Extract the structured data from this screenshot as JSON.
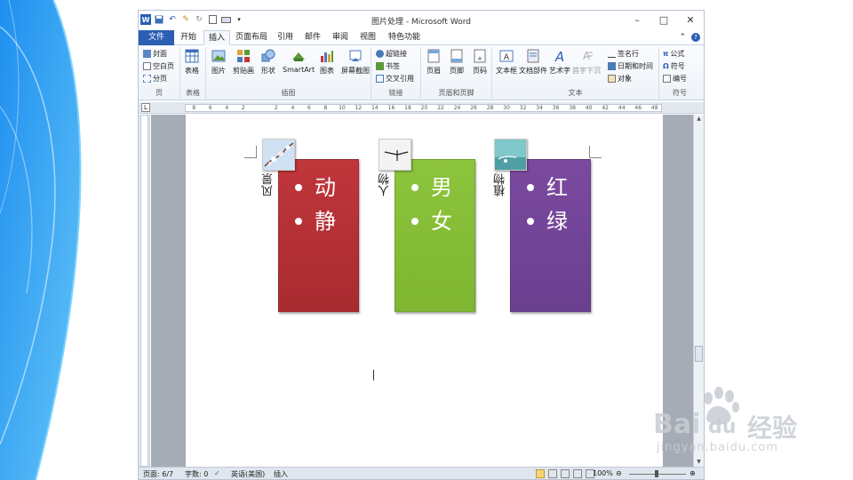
{
  "window": {
    "title": "图片处理 - Microsoft Word",
    "controls": {
      "minimize": "–",
      "maximize": "□",
      "close": "✕"
    }
  },
  "qat": {
    "icons": [
      "word-app-icon",
      "save-icon",
      "undo-icon",
      "format-painter-icon",
      "redo-icon",
      "new-doc-icon",
      "print-preview-icon",
      "customize-qat-icon"
    ]
  },
  "tabs": [
    {
      "label": "文件"
    },
    {
      "label": "开始"
    },
    {
      "label": "插入"
    },
    {
      "label": "页面布局"
    },
    {
      "label": "引用"
    },
    {
      "label": "邮件"
    },
    {
      "label": "审阅"
    },
    {
      "label": "视图"
    },
    {
      "label": "特色功能"
    }
  ],
  "active_tab": "插入",
  "ribbon": {
    "pages": {
      "label": "页",
      "items": [
        "封面",
        "空白页",
        "分页"
      ]
    },
    "tables": {
      "label": "表格",
      "items": [
        "表格"
      ]
    },
    "illustrations": {
      "label": "插图",
      "items": [
        "图片",
        "剪贴画",
        "形状",
        "SmartArt",
        "图表",
        "屏幕截图"
      ]
    },
    "links": {
      "label": "链接",
      "items": [
        "超链接",
        "书签",
        "交叉引用"
      ]
    },
    "header_footer": {
      "label": "页眉和页脚",
      "items": [
        "页眉",
        "页脚",
        "页码"
      ]
    },
    "text": {
      "label": "文本",
      "items": [
        "文本框",
        "文档部件",
        "艺术字",
        "首字下沉"
      ],
      "side": [
        "签名行",
        "日期和时间",
        "对象"
      ]
    },
    "symbols": {
      "label": "符号",
      "items": [
        "公式",
        "符号",
        "编号"
      ]
    }
  },
  "ruler": {
    "labels": [
      "8",
      "6",
      "4",
      "2",
      "",
      "2",
      "4",
      "6",
      "8",
      "10",
      "12",
      "14",
      "16",
      "18",
      "20",
      "22",
      "24",
      "26",
      "28",
      "30",
      "32",
      "34",
      "36",
      "38",
      "40",
      "42",
      "44",
      "46",
      "48"
    ]
  },
  "diagram": {
    "cards": [
      {
        "label": "风景",
        "items": [
          "动",
          "静"
        ],
        "color": "#c0363b",
        "color2": "#a82b30"
      },
      {
        "label": "人物",
        "items": [
          "男",
          "女"
        ],
        "color": "#8cc43c",
        "color2": "#7fb632"
      },
      {
        "label": "植物",
        "items": [
          "红",
          "绿"
        ],
        "color": "#7b4aa0",
        "color2": "#6a3f8e"
      }
    ]
  },
  "status": {
    "page": "页面: 6/7",
    "words": "字数: 0",
    "language": "英语(美国)",
    "mode": "插入",
    "zoom": "100%"
  },
  "watermark": {
    "brand": "Bai",
    "brand2": "du",
    "cn": "经验",
    "url": "jingyan.baidu.com"
  }
}
